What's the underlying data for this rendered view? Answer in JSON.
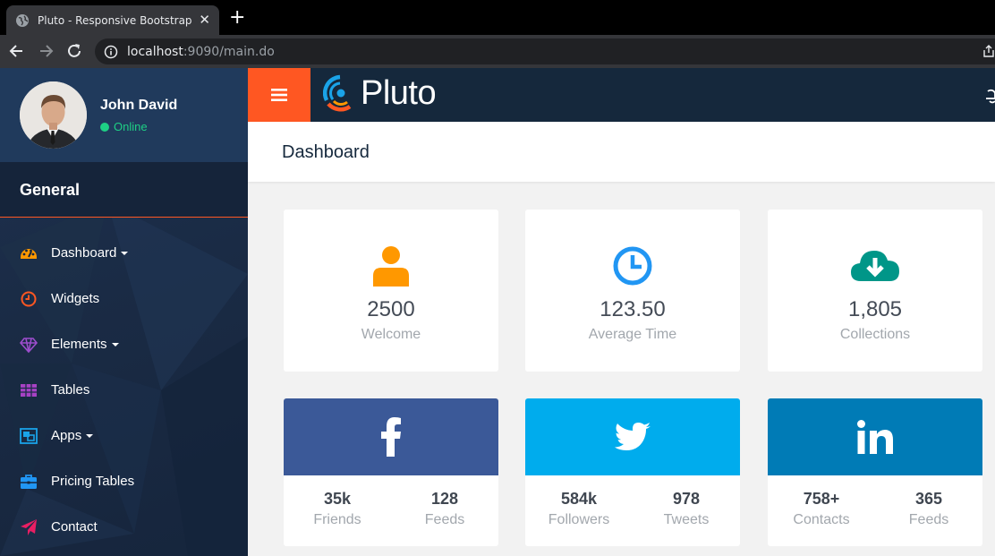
{
  "browser": {
    "tab_title": "Pluto - Responsive Bootstrap Ad",
    "tab_close": "✕",
    "new_tab": "+",
    "url_host": "localhost",
    "url_path": ":9090/main.do"
  },
  "user": {
    "name": "John David",
    "status": "Online"
  },
  "sidebar": {
    "section_title": "General",
    "items": [
      {
        "label": "Dashboard",
        "icon": "dashboard-icon",
        "color": "#ff9800",
        "dropdown": true
      },
      {
        "label": "Widgets",
        "icon": "clock-icon",
        "color": "#ff5722",
        "dropdown": false
      },
      {
        "label": "Elements",
        "icon": "diamond-icon",
        "color": "#9c4dcc",
        "dropdown": true
      },
      {
        "label": "Tables",
        "icon": "table-icon",
        "color": "#a742c4",
        "dropdown": false
      },
      {
        "label": "Apps",
        "icon": "object-group-icon",
        "color": "#1aa3e8",
        "dropdown": true
      },
      {
        "label": "Pricing Tables",
        "icon": "briefcase-icon",
        "color": "#2196f3",
        "dropdown": false
      },
      {
        "label": "Contact",
        "icon": "paper-plane-icon",
        "color": "#e91e63",
        "dropdown": false
      }
    ]
  },
  "header": {
    "logo_text": "Pluto",
    "page_title": "Dashboard"
  },
  "counters": [
    {
      "value": "2500",
      "label": "Welcome",
      "icon": "user-icon",
      "color": "#ff9800"
    },
    {
      "value": "123.50",
      "label": "Average Time",
      "icon": "clock-icon",
      "color": "#2196f3"
    },
    {
      "value": "1,805",
      "label": "Collections",
      "icon": "cloud-download-icon",
      "color": "#009688"
    }
  ],
  "social": [
    {
      "network": "facebook",
      "icon": "facebook-icon",
      "color": "#3b5998",
      "stats": [
        {
          "value": "35k",
          "label": "Friends"
        },
        {
          "value": "128",
          "label": "Feeds"
        }
      ]
    },
    {
      "network": "twitter",
      "icon": "twitter-icon",
      "color": "#00aced",
      "stats": [
        {
          "value": "584k",
          "label": "Followers"
        },
        {
          "value": "978",
          "label": "Tweets"
        }
      ]
    },
    {
      "network": "linkedin",
      "icon": "linkedin-icon",
      "color": "#007bb6",
      "stats": [
        {
          "value": "758+",
          "label": "Contacts"
        },
        {
          "value": "365",
          "label": "Feeds"
        }
      ]
    }
  ],
  "colors": {
    "accent": "#ff5722",
    "header_bg": "#15283c",
    "online": "#1ed085"
  }
}
